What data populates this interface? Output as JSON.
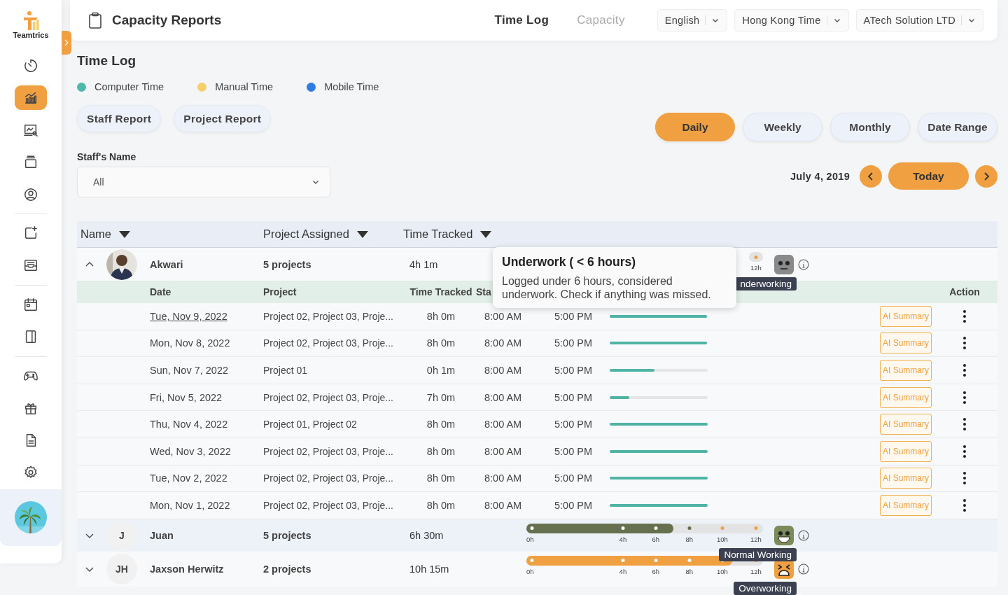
{
  "sidebar": {
    "logo": "Teamtrics",
    "groups": [
      [
        {
          "kind": "timer",
          "selected": false
        },
        {
          "kind": "chart",
          "selected": true
        },
        {
          "kind": "monitor",
          "selected": false
        },
        {
          "kind": "stack",
          "selected": false
        },
        {
          "kind": "user",
          "selected": false
        }
      ],
      [
        {
          "kind": "add",
          "selected": false
        },
        {
          "kind": "inbox",
          "selected": false
        }
      ],
      [
        {
          "kind": "calendar",
          "selected": false
        },
        {
          "kind": "panel",
          "selected": false
        }
      ],
      [
        {
          "kind": "gamepad",
          "selected": false
        },
        {
          "kind": "gift",
          "selected": false
        },
        {
          "kind": "document",
          "selected": false
        },
        {
          "kind": "settings",
          "selected": false
        }
      ]
    ],
    "avatar": {
      "kind": "picture"
    }
  },
  "header": {
    "title": "Capacity Reports",
    "tabs": [
      {
        "label": "Time Log",
        "selected": true
      },
      {
        "label": "Capacity",
        "selected": false
      }
    ],
    "dropdowns": [
      "English",
      "Hong Kong Time",
      "ATech Solution LTD"
    ]
  },
  "page_title": "Time Log",
  "legend": [
    {
      "label": "Computer Time",
      "color": "#4fb8a8"
    },
    {
      "label": "Manual Time",
      "color": "#f5cf6a"
    },
    {
      "label": "Mobile Time",
      "color": "#2f7be6"
    }
  ],
  "report_buttons": [
    "Staff Report",
    "Project Report"
  ],
  "periods": [
    {
      "label": "Daily",
      "selected": true
    },
    {
      "label": "Weekly",
      "selected": false
    },
    {
      "label": "Monthly",
      "selected": false
    },
    {
      "label": "Date Range",
      "selected": false
    }
  ],
  "staff_filter": {
    "label": "Staff's Name",
    "value": "All"
  },
  "date_nav": {
    "date": "July 4, 2019",
    "today": "Today"
  },
  "table": {
    "columns": [
      "Name",
      "Project Assigned",
      "Time Tracked"
    ],
    "tooltip": {
      "title": "Underwork ( < 6 hours)",
      "text": "Logged under 6 hours, considered underwork. Check if anything was missed."
    },
    "rows": [
      {
        "name": "Akwari",
        "expanded": true,
        "projects": "5 projects",
        "time": "4h 1m",
        "ticks": [
          "12h"
        ],
        "status": {
          "kind": "under",
          "label": "nderworking"
        },
        "detail": {
          "columns": [
            "Date",
            "Project",
            "Time Tracked",
            "Sta",
            "Action"
          ],
          "entries": [
            {
              "date": "Tue, Nov 9, 2022",
              "link": true,
              "project": "Project 02, Project 03, Proje...",
              "time": "8h 0m",
              "start": "8:00 AM",
              "end": "5:00 PM",
              "level": 0.99,
              "action": "AI Summary"
            },
            {
              "date": "Mon, Nov 8, 2022",
              "link": false,
              "project": "Project 02, Project 03, Proje...",
              "time": "8h 0m",
              "start": "8:00 AM",
              "end": "5:00 PM",
              "level": 0.99,
              "action": "AI Summary"
            },
            {
              "date": "Sun, Nov 7, 2022",
              "link": false,
              "project": "Project 01",
              "time": "0h 1m",
              "start": "8:00 AM",
              "end": "5:00 PM",
              "level": 0.46,
              "action": "AI Summary"
            },
            {
              "date": "Fri, Nov 5, 2022",
              "link": false,
              "project": "Project 02, Project 03, Proje...",
              "time": "7h 0m",
              "start": "8:00 AM",
              "end": "5:00 PM",
              "level": 0.2,
              "action": "AI Summary"
            },
            {
              "date": "Thu, Nov 4, 2022",
              "link": false,
              "project": "Project 01, Project 02",
              "time": "8h 0m",
              "start": "8:00 AM",
              "end": "5:00 PM",
              "level": 1,
              "action": "AI Summary"
            },
            {
              "date": "Wed, Nov 3, 2022",
              "link": false,
              "project": "Project 02, Project 03, Proje...",
              "time": "8h 0m",
              "start": "8:00 AM",
              "end": "5:00 PM",
              "level": 1,
              "action": "AI Summary"
            },
            {
              "date": "Tue, Nov 2, 2022",
              "link": false,
              "project": "Project 02, Project 03, Proje...",
              "time": "8h 0m",
              "start": "8:00 AM",
              "end": "5:00 PM",
              "level": 1,
              "action": "AI Summary"
            },
            {
              "date": "Mon, Nov 1, 2022",
              "link": false,
              "project": "Project 02, Project 03, Proje...",
              "time": "8h 0m",
              "start": "8:00 AM",
              "end": "5:00 PM",
              "level": 1,
              "action": "AI Summary"
            }
          ]
        }
      },
      {
        "name": "Juan",
        "kind": "initials",
        "initials": "J",
        "expanded": false,
        "projects": "5 projects",
        "time": "6h 30m",
        "level": 0.62,
        "color": "#66704f",
        "ticks": [
          "0h",
          "4h",
          "6h",
          "8h",
          "10h",
          "12h"
        ],
        "status": {
          "kind": "normal",
          "label": "Normal Working"
        }
      },
      {
        "name": "Jaxson Herwitz",
        "kind": "initials",
        "initials": "JH",
        "expanded": false,
        "projects": "2 projects",
        "time": "10h 15m",
        "level": 0.87,
        "color": "#f0a040",
        "ticks": [
          "0h",
          "4h",
          "6h",
          "8h",
          "10h",
          "12h"
        ],
        "status": {
          "kind": "over",
          "label": "Overworking"
        }
      }
    ]
  }
}
